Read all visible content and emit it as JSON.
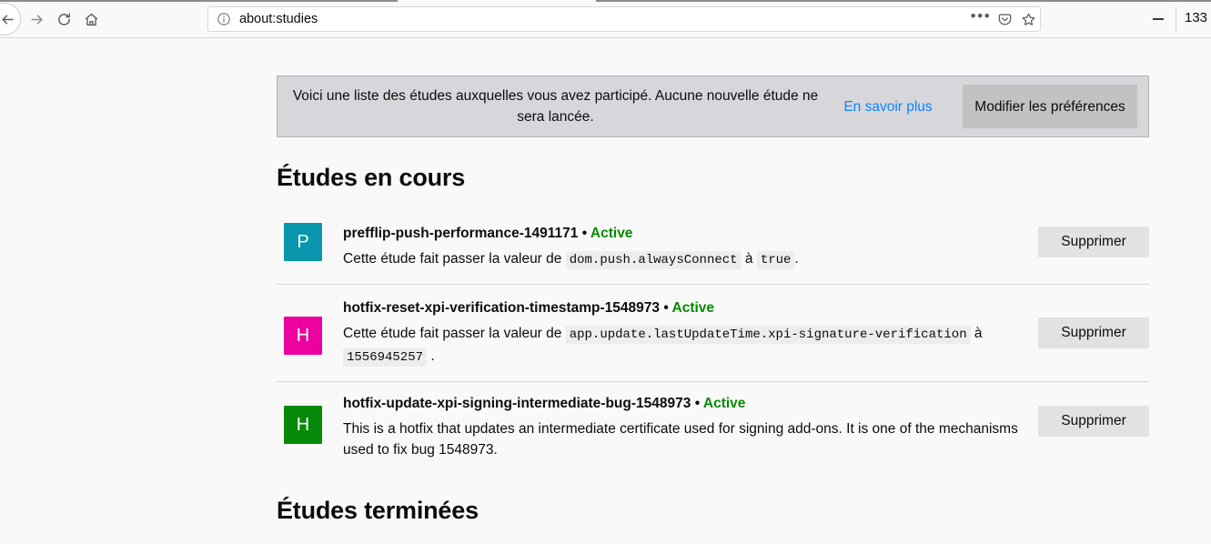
{
  "browser": {
    "back_icon": "back-arrow-icon",
    "forward_icon": "forward-arrow-icon",
    "reload_icon": "reload-icon",
    "home_icon": "home-icon",
    "identity_icon": "info-circle-icon",
    "url": "about:studies",
    "page_actions_icon": "ellipsis-icon",
    "pocket_icon": "pocket-icon",
    "bookmark_icon": "star-icon",
    "minimize_icon": "minimize-icon",
    "zoom_level": "133 %"
  },
  "banner": {
    "message": "Voici une liste des études auxquelles vous avez participé. Aucune nouvelle étude ne sera lancée.",
    "link_label": "En savoir plus",
    "button_label": "Modifier les préférences"
  },
  "sections": {
    "current_title": "Études en cours",
    "completed_title": "Études terminées"
  },
  "studies": [
    {
      "avatar_letter": "P",
      "avatar_color": "#0a96ac",
      "name": "prefflip-push-performance-1491171",
      "separator": "•",
      "state": "Active",
      "description_prefix": "Cette étude fait passer la valeur de",
      "pref_name": "dom.push.alwaysConnect",
      "description_middle": "à",
      "pref_value": "true",
      "description_suffix": ".",
      "remove_label": "Supprimer"
    },
    {
      "avatar_letter": "H",
      "avatar_color": "#ec009f",
      "name": "hotfix-reset-xpi-verification-timestamp-1548973",
      "separator": "•",
      "state": "Active",
      "description_prefix": "Cette étude fait passer la valeur de",
      "pref_name": "app.update.lastUpdateTime.xpi-signature-verification",
      "description_middle": "à",
      "pref_value": "1556945257",
      "description_suffix": ".",
      "remove_label": "Supprimer"
    },
    {
      "avatar_letter": "H",
      "avatar_color": "#078a09",
      "name": "hotfix-update-xpi-signing-intermediate-bug-1548973",
      "separator": "•",
      "state": "Active",
      "description_full": "This is a hotfix that updates an intermediate certificate used for signing add-ons. It is one of the mechanisms used to fix bug 1548973.",
      "remove_label": "Supprimer"
    }
  ]
}
